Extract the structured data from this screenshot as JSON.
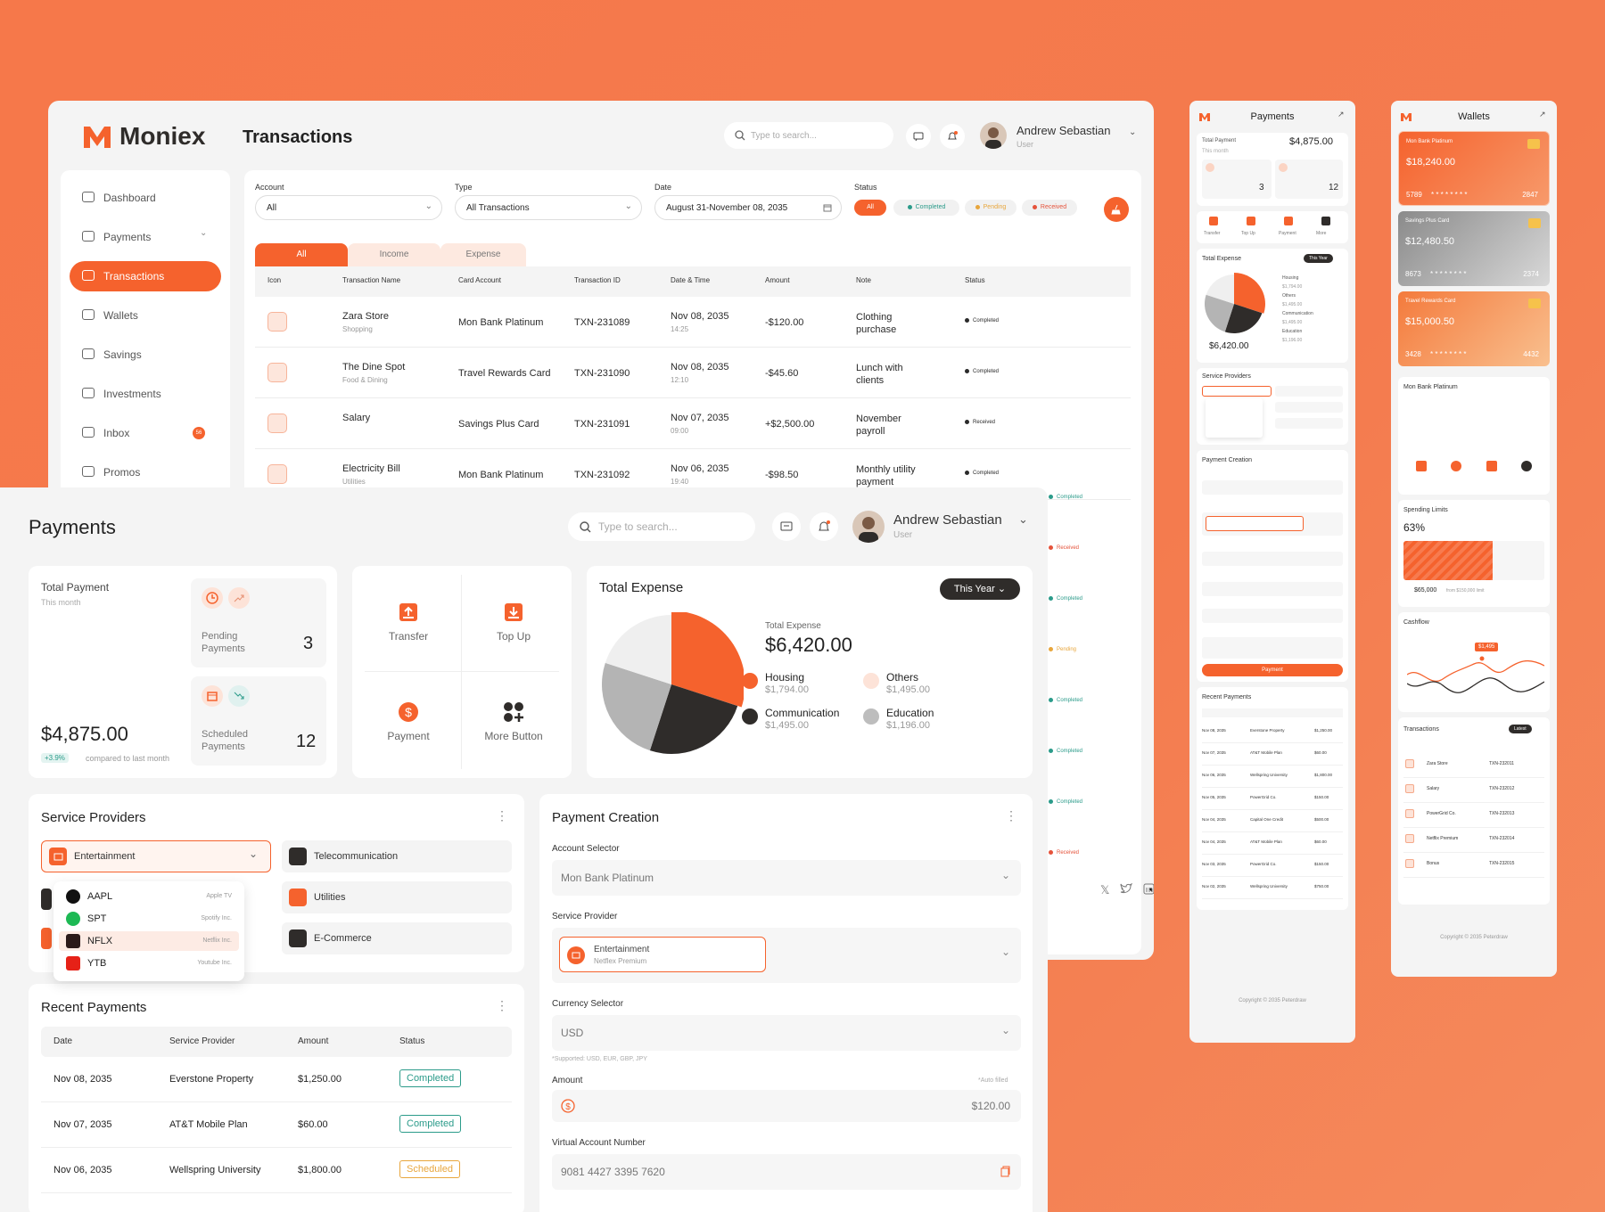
{
  "colors": {
    "accent": "#f5622d",
    "bg": "#f6784a",
    "completed": "#2b9b8a",
    "received": "#e5533b",
    "pending": "#e8a63c",
    "dark": "#2f2c2a"
  },
  "brand": "Moniex",
  "user": {
    "name": "Andrew Sebastian",
    "role": "User"
  },
  "search": {
    "placeholder": "Type to search..."
  },
  "tx": {
    "title": "Transactions",
    "nav": [
      {
        "label": "Dashboard",
        "icon": "grid-icon"
      },
      {
        "label": "Payments",
        "icon": "wallet-icon"
      },
      {
        "label": "Transactions",
        "icon": "list-icon",
        "active": true
      },
      {
        "label": "Wallets",
        "icon": "card-icon"
      },
      {
        "label": "Savings",
        "icon": "piggy-icon"
      },
      {
        "label": "Investments",
        "icon": "dollar-circle-icon"
      },
      {
        "label": "Inbox",
        "icon": "mailbox-icon",
        "badge": "56"
      },
      {
        "label": "Promos",
        "icon": "percent-icon"
      }
    ],
    "filters": {
      "account_label": "Account",
      "account_value": "All",
      "type_label": "Type",
      "type_value": "All Transactions",
      "date_label": "Date",
      "date_value": "August 31-November 08, 2035",
      "status_label": "Status",
      "status_all": "All",
      "status_completed": "Completed",
      "status_pending": "Pending",
      "status_received": "Received"
    },
    "tabs": [
      "All",
      "Income",
      "Expense"
    ],
    "columns": [
      "Icon",
      "Transaction Name",
      "Card Account",
      "Transaction ID",
      "Date & Time",
      "Amount",
      "Note",
      "Status"
    ],
    "rows": [
      {
        "name": "Zara Store",
        "cat": "Shopping",
        "card": "Mon Bank Platinum",
        "id": "TXN-231089",
        "date": "Nov 08, 2035",
        "time": "14:25",
        "amount": "-$120.00",
        "note": "Clothing purchase",
        "status": "Completed"
      },
      {
        "name": "The Dine Spot",
        "cat": "Food & Dining",
        "card": "Travel Rewards Card",
        "id": "TXN-231090",
        "date": "Nov 08, 2035",
        "time": "12:10",
        "amount": "-$45.60",
        "note": "Lunch with clients",
        "status": "Completed"
      },
      {
        "name": "Salary",
        "cat": "",
        "card": "Savings Plus Card",
        "id": "TXN-231091",
        "date": "Nov 07, 2035",
        "time": "09:00",
        "amount": "+$2,500.00",
        "note": "November payroll",
        "status": "Received"
      },
      {
        "name": "Electricity Bill",
        "cat": "Utilities",
        "card": "Mon Bank Platinum",
        "id": "TXN-231092",
        "date": "Nov 06, 2035",
        "time": "19:40",
        "amount": "-$98.50",
        "note": "Monthly utility payment",
        "status": "Completed"
      }
    ],
    "extra_status": [
      "Completed",
      "Received",
      "Completed",
      "Pending",
      "Completed",
      "Completed",
      "Completed",
      "Received"
    ]
  },
  "pay": {
    "title": "Payments",
    "total_label": "Total Payment",
    "total_period": "This month",
    "total_value": "$4,875.00",
    "total_change": "+3.9%",
    "total_compare": "compared to last month",
    "pending_label": "Pending Payments",
    "pending_count": "3",
    "scheduled_label": "Scheduled Payments",
    "scheduled_count": "12",
    "actions": [
      "Transfer",
      "Top Up",
      "Payment",
      "More Button"
    ],
    "expense": {
      "title": "Total Expense",
      "filter": "This Year",
      "label": "Total Expense",
      "value": "$6,420.00",
      "items": [
        {
          "name": "Housing",
          "value": "$1,794.00"
        },
        {
          "name": "Others",
          "value": "$1,495.00"
        },
        {
          "name": "Communication",
          "value": "$1,495.00"
        },
        {
          "name": "Education",
          "value": "$1,196.00"
        }
      ]
    },
    "providers": {
      "title": "Service Providers",
      "selected": "Entertainment",
      "others": [
        "Telecommunication",
        "Utilities",
        "E-Commerce"
      ],
      "dropdown": [
        {
          "code": "AAPL",
          "name": "Apple TV"
        },
        {
          "code": "SPT",
          "name": "Spotify Inc."
        },
        {
          "code": "NFLX",
          "name": "Netflix Inc."
        },
        {
          "code": "YTB",
          "name": "Youtube Inc."
        }
      ]
    },
    "recent": {
      "title": "Recent Payments",
      "columns": [
        "Date",
        "Service Provider",
        "Amount",
        "Status"
      ],
      "rows": [
        {
          "date": "Nov 08, 2035",
          "provider": "Everstone Property",
          "amount": "$1,250.00",
          "status": "Completed"
        },
        {
          "date": "Nov 07, 2035",
          "provider": "AT&T Mobile Plan",
          "amount": "$60.00",
          "status": "Completed"
        },
        {
          "date": "Nov 06, 2035",
          "provider": "Wellspring University",
          "amount": "$1,800.00",
          "status": "Scheduled"
        }
      ]
    },
    "creation": {
      "title": "Payment Creation",
      "account_label": "Account Selector",
      "account_value": "Mon Bank Platinum",
      "provider_label": "Service Provider",
      "provider_value": "Entertainment",
      "provider_sub": "Netflex Premium",
      "currency_label": "Currency Selector",
      "currency_value": "USD",
      "currency_note": "*Supported: USD, EUR, GBP, JPY",
      "amount_label": "Amount",
      "amount_note": "*Auto filled",
      "amount_value": "$120.00",
      "van_label": "Virtual Account Number",
      "van_value": "9081 4427 3395 7620"
    }
  },
  "mobile_pay": {
    "title": "Payments",
    "total_label": "Total Payment",
    "total_value": "$4,875.00",
    "period": "This month",
    "pending": "3",
    "scheduled": "12",
    "actions": [
      "Transfer",
      "Top Up",
      "Payment",
      "More"
    ],
    "expense_title": "Total Expense",
    "expense_filter": "This Year",
    "expense_value": "$6,420.00",
    "providers_title": "Service Providers",
    "creation_title": "Payment Creation",
    "pay_button": "Payment",
    "recent_title": "Recent Payments",
    "recent": [
      [
        "Nov 08, 2035",
        "Everstone Property",
        "$1,250.00"
      ],
      [
        "Nov 07, 2035",
        "AT&T Mobile Plan",
        "$60.00"
      ],
      [
        "Nov 06, 2035",
        "Wellspring University",
        "$1,800.00"
      ],
      [
        "Nov 05, 2035",
        "PowerGrid Co.",
        "$150.00"
      ],
      [
        "Nov 04, 2035",
        "Capital One Credit",
        "$500.00"
      ],
      [
        "Nov 04, 2035",
        "AT&T Mobile Plan",
        "$60.00"
      ],
      [
        "Nov 03, 2035",
        "PowerGrid Co.",
        "$150.00"
      ],
      [
        "Nov 02, 2035",
        "Wellspring University",
        "$750.00"
      ]
    ],
    "footer": "Copyright © 2035 Peterdraw"
  },
  "mobile_wallet": {
    "title": "Wallets",
    "cards": [
      {
        "name": "Mon Bank Platinum",
        "balance": "$18,240.00",
        "first": "5789",
        "last": "2847"
      },
      {
        "name": "Savings Plus Card",
        "balance": "$12,480.50",
        "first": "8673",
        "last": "2374"
      },
      {
        "name": "Travel Rewards Card",
        "balance": "$15,000.50",
        "first": "3428",
        "last": "4432"
      }
    ],
    "detail_title": "Mon Bank Platinum",
    "limits_title": "Spending Limits",
    "limits_value": "63%",
    "limits_amount": "$65,000",
    "limits_of": "from $150,000 limit",
    "cashflow_title": "Cashflow",
    "cashflow_tag": "$1,495",
    "tx_title": "Transactions",
    "tx_filter": "Latest",
    "tx": [
      [
        "Zara Store",
        "TXN-232011"
      ],
      [
        "Salary",
        "TXN-232012"
      ],
      [
        "PowerGrid Co.",
        "TXN-232013"
      ],
      [
        "Netflix Premium",
        "TXN-232014"
      ],
      [
        "Bonus",
        "TXN-232015"
      ]
    ],
    "footer": "Copyright © 2035 Peterdraw"
  }
}
